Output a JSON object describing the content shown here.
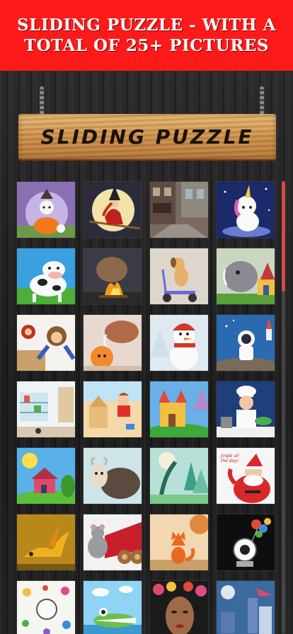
{
  "promo": {
    "line1": "SLIDING PUZZLE - WITH A",
    "line2": "TOTAL OF 25+ PICTURES"
  },
  "sign": {
    "title": "SLIDING PUZZLE"
  },
  "colors": {
    "banner": "#ff1a1a",
    "sign_wood": "#d39a58",
    "scroll_thumb": "#d34a4a"
  },
  "scroll": {
    "position_fraction": 0.0,
    "visible_fraction": 0.25
  },
  "tiles": [
    {
      "name": "puzzle-tile-cat-pumpkin",
      "picture": "cat on pumpkin",
      "caption": ""
    },
    {
      "name": "puzzle-tile-witch-broom",
      "picture": "witch on broom",
      "caption": ""
    },
    {
      "name": "puzzle-tile-street",
      "picture": "city street",
      "caption": ""
    },
    {
      "name": "puzzle-tile-unicorn",
      "picture": "unicorn",
      "caption": ""
    },
    {
      "name": "puzzle-tile-cow",
      "picture": "cow",
      "caption": ""
    },
    {
      "name": "puzzle-tile-campfire",
      "picture": "campfire",
      "caption": ""
    },
    {
      "name": "puzzle-tile-dog-scooter",
      "picture": "dog on scooter",
      "caption": ""
    },
    {
      "name": "puzzle-tile-dinosaur-house",
      "picture": "dinosaur and house",
      "caption": ""
    },
    {
      "name": "puzzle-tile-monkeys",
      "picture": "monkeys",
      "caption": ""
    },
    {
      "name": "puzzle-tile-mammoth",
      "picture": "mammoth",
      "caption": ""
    },
    {
      "name": "puzzle-tile-snowman",
      "picture": "snowman",
      "caption": ""
    },
    {
      "name": "puzzle-tile-astronaut",
      "picture": "astronaut",
      "caption": ""
    },
    {
      "name": "puzzle-tile-toy-room",
      "picture": "toy room",
      "caption": ""
    },
    {
      "name": "puzzle-tile-beach-kid",
      "picture": "kid at beach",
      "caption": ""
    },
    {
      "name": "puzzle-tile-castle",
      "picture": "castle",
      "caption": ""
    },
    {
      "name": "puzzle-tile-chef",
      "picture": "chef",
      "caption": ""
    },
    {
      "name": "puzzle-tile-sun-house",
      "picture": "sun and house",
      "caption": ""
    },
    {
      "name": "puzzle-tile-sheep",
      "picture": "sheep",
      "caption": ""
    },
    {
      "name": "puzzle-tile-trees",
      "picture": "trees",
      "caption": ""
    },
    {
      "name": "puzzle-tile-santa",
      "picture": "santa",
      "caption": "Jingle all the day!"
    },
    {
      "name": "puzzle-tile-dragon",
      "picture": "dragon",
      "caption": ""
    },
    {
      "name": "puzzle-tile-mouse-logs",
      "picture": "mouse and logs",
      "caption": ""
    },
    {
      "name": "puzzle-tile-fox",
      "picture": "fox",
      "caption": ""
    },
    {
      "name": "puzzle-tile-balloons",
      "picture": "balloons",
      "caption": ""
    },
    {
      "name": "puzzle-tile-doodles",
      "picture": "doodles",
      "caption": ""
    },
    {
      "name": "puzzle-tile-crocodile",
      "picture": "crocodile",
      "caption": ""
    },
    {
      "name": "puzzle-tile-face-flowers",
      "picture": "face with flowers",
      "caption": ""
    },
    {
      "name": "puzzle-tile-city-art",
      "picture": "city art",
      "caption": ""
    }
  ]
}
